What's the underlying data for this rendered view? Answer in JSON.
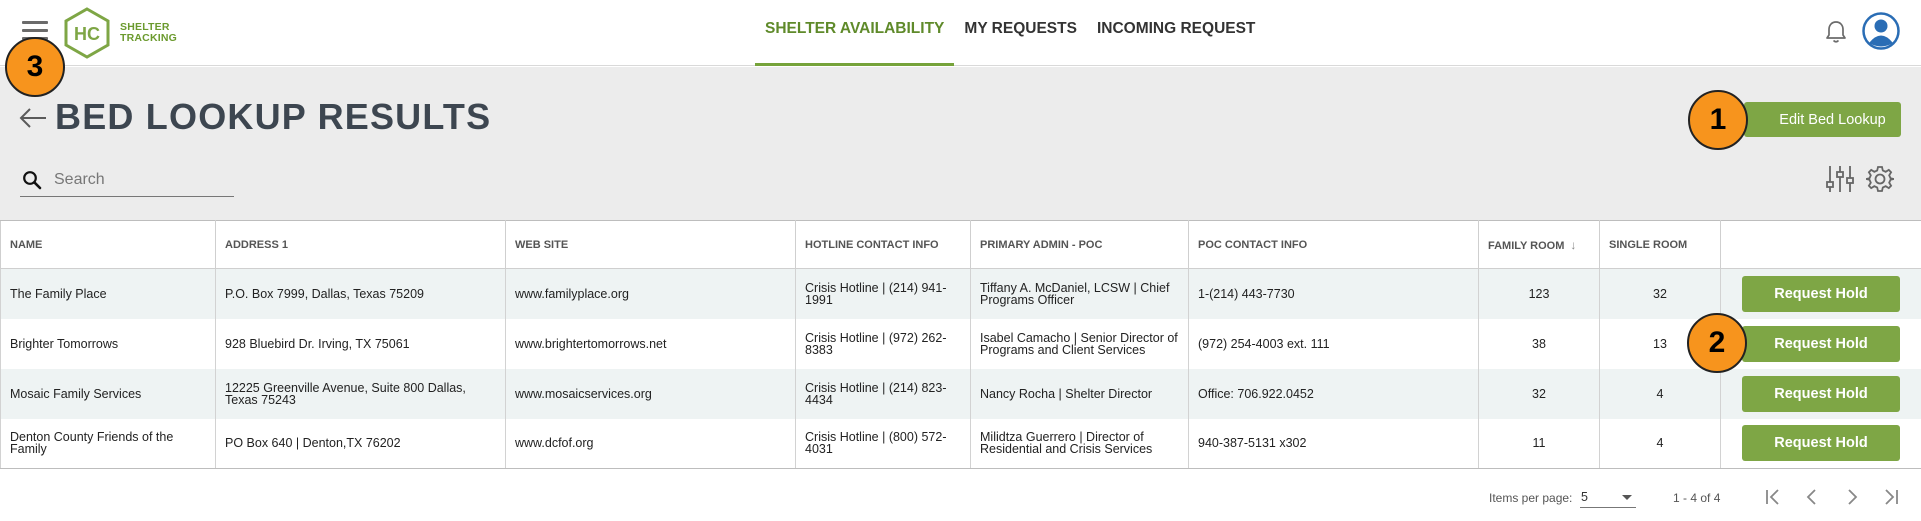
{
  "app": {
    "logo_text_line1": "SHELTER",
    "logo_text_line2": "TRACKING",
    "logo_mark": "HC",
    "nav": [
      {
        "label": "SHELTER AVAILABILITY",
        "active": true
      },
      {
        "label": "MY REQUESTS",
        "active": false
      },
      {
        "label": "INCOMING REQUEST",
        "active": false
      }
    ],
    "icons": {
      "menu": "hamburger-icon",
      "notifications": "bell-icon",
      "account": "user-avatar-icon"
    }
  },
  "page": {
    "title": "BED LOOKUP RESULTS",
    "edit_button": "Edit Bed Lookup",
    "search_placeholder": "Search",
    "toolbar_icons": [
      "filter-sliders-icon",
      "gear-icon"
    ]
  },
  "table": {
    "columns": [
      "NAME",
      "ADDRESS 1",
      "WEB SITE",
      "HOTLINE CONTACT INFO",
      "PRIMARY ADMIN - POC",
      "POC CONTACT INFO",
      "FAMILY ROOM",
      "SINGLE ROOM",
      ""
    ],
    "sorted_column": "FAMILY ROOM",
    "sort_direction": "descending",
    "action_label": "Request Hold",
    "rows": [
      {
        "name": "The Family Place",
        "address": "P.O. Box 7999, Dallas, Texas 75209",
        "website": "www.familyplace.org",
        "hotline": "Crisis Hotline | (214) 941-1991",
        "admin": "Tiffany A. McDaniel, LCSW | Chief Programs Officer",
        "poc": "1-(214) 443-7730",
        "family": "123",
        "single": "32"
      },
      {
        "name": "Brighter Tomorrows",
        "address": "928 Bluebird Dr. Irving, TX 75061",
        "website": "www.brightertomorrows.net",
        "hotline": "Crisis Hotline | (972) 262-8383",
        "admin": "Isabel Camacho | Senior Director of Programs and Client Services",
        "poc": "(972) 254-4003 ext. 111",
        "family": "38",
        "single": "13"
      },
      {
        "name": "Mosaic Family Services",
        "address": "12225 Greenville Avenue, Suite 800 Dallas, Texas 75243",
        "website": "www.mosaicservices.org",
        "hotline": "Crisis Hotline | (214) 823-4434",
        "admin": "Nancy Rocha | Shelter Director",
        "poc": "Office: 706.922.0452",
        "family": "32",
        "single": "4"
      },
      {
        "name": "Denton County Friends of the Family",
        "address": "PO Box 640 | Denton,TX 76202",
        "website": "www.dcfof.org",
        "hotline": "Crisis Hotline | (800) 572-4031",
        "admin": "Milidtza Guerrero | Director of Residential and Crisis Services",
        "poc": "940-387-5131 x302",
        "family": "11",
        "single": "4"
      }
    ]
  },
  "pagination": {
    "items_per_page_label": "Items per page:",
    "items_per_page": "5",
    "range": "1 - 4 of 4",
    "buttons": [
      "first-page-icon",
      "previous-page-icon",
      "next-page-icon",
      "last-page-icon"
    ]
  },
  "annotations": {
    "badge1": "1",
    "badge2": "2",
    "badge3": "3",
    "color": "#f7941d"
  },
  "colors": {
    "accent": "#7ea645",
    "nav_active": "#5f8a2a",
    "title": "#3d4650",
    "band": "#ececec",
    "row_alt": "#eef3f3",
    "avatar": "#2a6db5"
  }
}
